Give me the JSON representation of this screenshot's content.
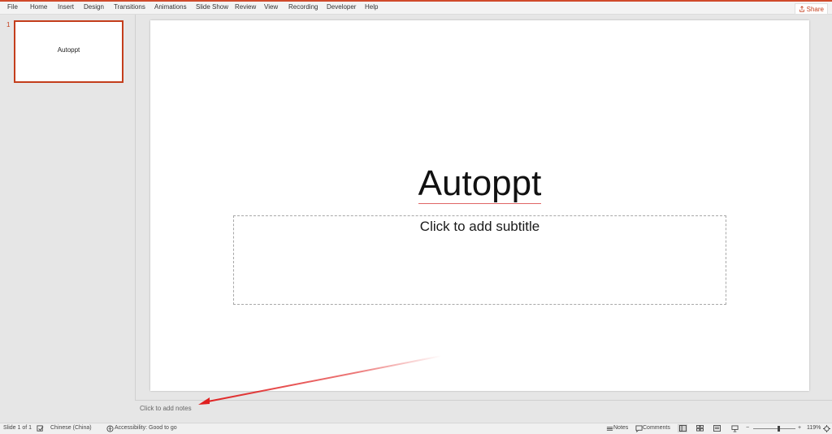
{
  "menu": {
    "items": [
      {
        "label": "File"
      },
      {
        "label": "Home"
      },
      {
        "label": "Insert"
      },
      {
        "label": "Design"
      },
      {
        "label": "Transitions"
      },
      {
        "label": "Animations"
      },
      {
        "label": "Slide Show"
      },
      {
        "label": "Review"
      },
      {
        "label": "View"
      },
      {
        "label": "Recording"
      },
      {
        "label": "Developer"
      },
      {
        "label": "Help"
      }
    ],
    "share_label": "Share"
  },
  "thumbnails": [
    {
      "number": "1",
      "title": "Autoppt"
    }
  ],
  "slide": {
    "title": "Autoppt",
    "subtitle_placeholder": "Click to add subtitle"
  },
  "notes": {
    "placeholder": "Click to add notes"
  },
  "status": {
    "slide_counter": "Slide 1 of 1",
    "language": "Chinese (China)",
    "accessibility": "Accessibility: Good to go",
    "notes_label": "Notes",
    "comments_label": "Comments",
    "zoom": "119%",
    "zoom_level_fraction": 0.6
  },
  "colors": {
    "accent": "#c43e1c",
    "arrow": "#e02020"
  },
  "icons": {
    "share": "share-icon",
    "spellcheck": "spellcheck-icon",
    "accessibility": "accessibility-icon",
    "notes": "notes-icon",
    "comments": "comments-icon",
    "normal_view": "normal-view-icon",
    "sorter_view": "slide-sorter-icon",
    "reading_view": "reading-view-icon",
    "slideshow": "slideshow-icon",
    "fit": "fit-to-window-icon"
  }
}
